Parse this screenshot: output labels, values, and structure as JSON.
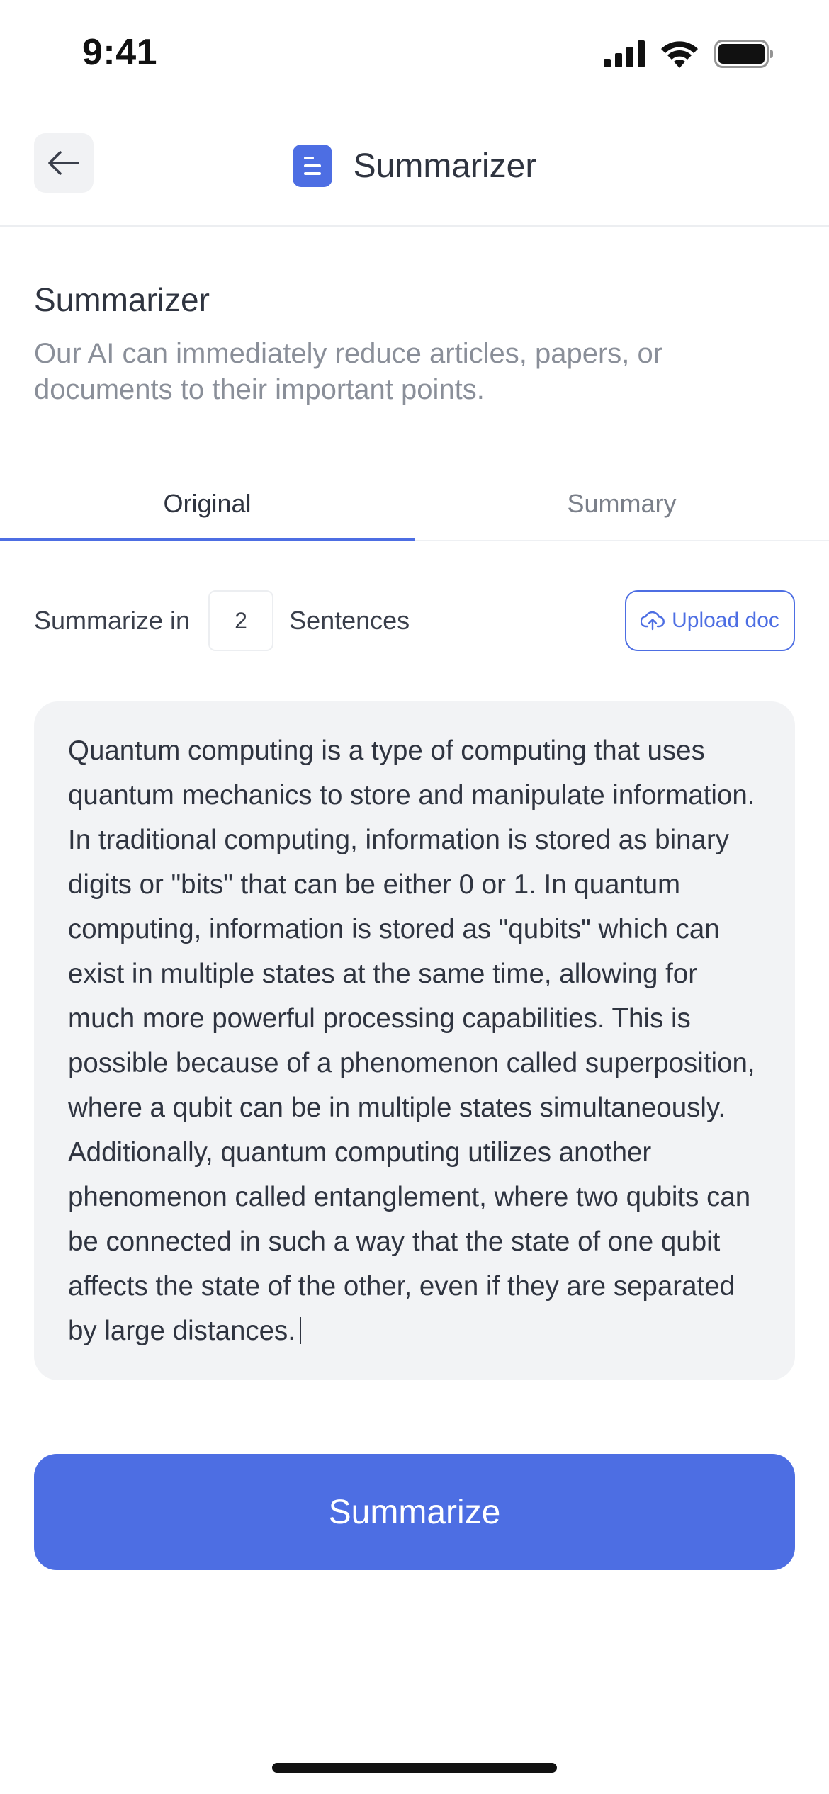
{
  "status_bar": {
    "time": "9:41"
  },
  "header": {
    "title": "Summarizer"
  },
  "intro": {
    "title": "Summarizer",
    "description": "Our AI can immediately reduce articles, papers, or documents to their important points."
  },
  "tabs": [
    {
      "label": "Original",
      "active": true
    },
    {
      "label": "Summary",
      "active": false
    }
  ],
  "options": {
    "prefix_label": "Summarize in",
    "sentence_count": "2",
    "suffix_label": "Sentences",
    "upload_label": "Upload doc"
  },
  "editor": {
    "text": "Quantum computing is a type of computing that uses quantum mechanics to store and manipulate information. In traditional computing, information is stored as binary digits or \"bits\" that can be either 0 or 1. In quantum computing, information is stored as \"qubits\" which can exist in multiple states at the same time, allowing for much more powerful processing capabilities. This is possible because of a phenomenon called superposition, where a qubit can be in multiple states simultaneously. Additionally, quantum computing utilizes another phenomenon called entanglement, where two qubits can be connected in such a way that the state of one qubit affects the state of the other, even if they are separated by large distances."
  },
  "actions": {
    "summarize_label": "Summarize"
  },
  "colors": {
    "accent": "#4d6ee3",
    "text_area_bg": "#f2f3f5",
    "muted_text": "#8a8f99"
  },
  "icons": {
    "back": "arrow-left-icon",
    "app": "document-icon",
    "upload": "cloud-upload-icon",
    "signal": "cellular-signal-icon",
    "wifi": "wifi-icon",
    "battery": "battery-icon"
  }
}
